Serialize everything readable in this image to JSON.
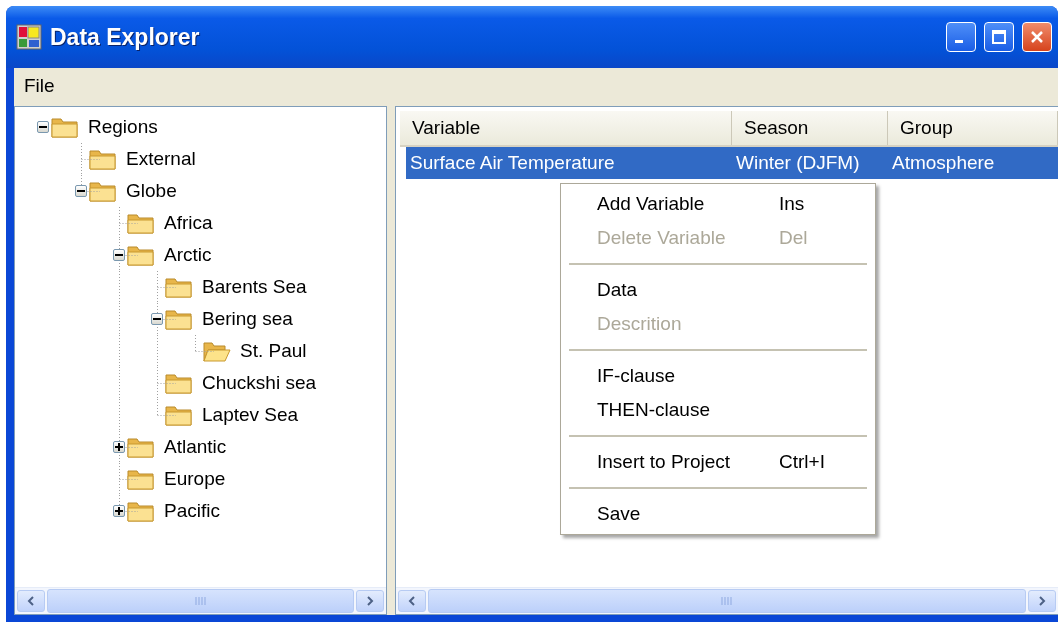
{
  "window": {
    "title": "Data Explorer"
  },
  "menu_bar": [
    {
      "label": "File"
    }
  ],
  "tree": [
    {
      "label": "Regions",
      "expanded": true,
      "selected": false,
      "children": [
        {
          "label": "External",
          "selected": false
        },
        {
          "label": "Globe",
          "expanded": true,
          "selected": false,
          "children": [
            {
              "label": "Africa",
              "selected": false
            },
            {
              "label": "Arctic",
              "expanded": true,
              "selected": false,
              "children": [
                {
                  "label": "Barents Sea",
                  "selected": false
                },
                {
                  "label": "Bering sea",
                  "expanded": true,
                  "selected": false,
                  "children": [
                    {
                      "label": "St. Paul",
                      "selected": true
                    }
                  ]
                },
                {
                  "label": "Chuckshi sea",
                  "selected": false
                },
                {
                  "label": "Laptev Sea",
                  "selected": false
                }
              ]
            },
            {
              "label": "Atlantic",
              "expanded": false,
              "selected": false
            },
            {
              "label": "Europe",
              "selected": false
            },
            {
              "label": "Pacific",
              "expanded": false,
              "selected": false
            }
          ]
        }
      ]
    }
  ],
  "table": {
    "columns": [
      "Variable",
      "Season",
      "Group"
    ],
    "rows": [
      {
        "cells": [
          "Surface Air Temperature",
          "Winter (DJFM)",
          "Atmosphere"
        ],
        "selected": true
      }
    ]
  },
  "context_menu": {
    "items": [
      {
        "kind": "item",
        "label": "Add Variable",
        "shortcut": "Ins",
        "disabled": false
      },
      {
        "kind": "item",
        "label": "Delete Variable",
        "shortcut": "Del",
        "disabled": true
      },
      {
        "kind": "separator"
      },
      {
        "kind": "item",
        "label": "Data",
        "disabled": false
      },
      {
        "kind": "item",
        "label": "Descrition",
        "disabled": true
      },
      {
        "kind": "separator"
      },
      {
        "kind": "item",
        "label": "IF-clause",
        "disabled": false
      },
      {
        "kind": "item",
        "label": "THEN-clause",
        "disabled": false
      },
      {
        "kind": "separator"
      },
      {
        "kind": "item",
        "label": "Insert to Project",
        "shortcut": "Ctrl+I",
        "disabled": false
      },
      {
        "kind": "separator"
      },
      {
        "kind": "item",
        "label": "Save",
        "disabled": false
      }
    ]
  }
}
